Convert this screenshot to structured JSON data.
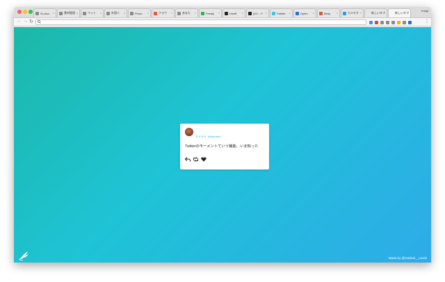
{
  "browser": {
    "tabs": [
      {
        "label": "Si-choc",
        "favicon": "folder-icon",
        "color": "#8a8a8a",
        "active": false
      },
      {
        "label": "素材管理",
        "favicon": "folder-icon",
        "color": "#8a8a8a",
        "active": false
      },
      {
        "label": "ペット",
        "favicon": "folder-icon",
        "color": "#8a8a8a",
        "active": false
      },
      {
        "label": "外国人",
        "favicon": "folder-icon",
        "color": "#8a8a8a",
        "active": false
      },
      {
        "label": "Photo",
        "favicon": "folder-icon",
        "color": "#8a8a8a",
        "active": false
      },
      {
        "label": "クラウ",
        "favicon": "cloud-app-icon",
        "color": "#e9553b",
        "active": false
      },
      {
        "label": "あなた",
        "favicon": "folder-icon",
        "color": "#8a8a8a",
        "active": false
      },
      {
        "label": "Feedly",
        "favicon": "feedly-icon",
        "color": "#2bb24c",
        "active": false
      },
      {
        "label": "Unoffi",
        "favicon": "github-icon",
        "color": "#222222",
        "active": false
      },
      {
        "label": "(I/O -- F",
        "favicon": "io-icon",
        "color": "#222222",
        "active": false
      },
      {
        "label": "Palette",
        "favicon": "palette-icon",
        "color": "#3fc3e8",
        "active": false
      },
      {
        "label": "Optim",
        "favicon": "optimize-icon",
        "color": "#2a6fd6",
        "active": false
      },
      {
        "label": "Birdy",
        "favicon": "birdy-icon",
        "color": "#d9583a",
        "active": false
      },
      {
        "label": "カメキチ",
        "favicon": "twitter-icon",
        "color": "#1da1f2",
        "active": false
      },
      {
        "label": "新しいタブ",
        "favicon": "blank-tab-icon",
        "color": "#e6e6e6",
        "active": false
      },
      {
        "label": "新しいタブ",
        "favicon": "blank-tab-icon",
        "color": "#f6f6f6",
        "active": true
      }
    ],
    "profile_name": "Imagi",
    "address": {
      "value": "",
      "icon": "search-icon"
    },
    "extensions": [
      {
        "name": "translate-icon",
        "color": "#4a8af4"
      },
      {
        "name": "gmail-icon",
        "color": "#d44638"
      },
      {
        "name": "camera-icon",
        "color": "#8a8a8a"
      },
      {
        "name": "bookmark-icon",
        "color": "#8a8a8a"
      },
      {
        "name": "feather-icon",
        "color": "#8a8a8a"
      },
      {
        "name": "star-icon",
        "color": "#f5b400"
      },
      {
        "name": "screen-icon",
        "color": "#8a8a8a"
      },
      {
        "name": "sync-icon",
        "color": "#2a6fd6"
      }
    ]
  },
  "tweet": {
    "author_name": "カメキチ",
    "author_handle": "@kameklt",
    "text": "Twitterのモーメントていう機能、いま知った"
  },
  "footer": {
    "credit": "Made by @Gabriel__Lewis"
  },
  "colors": {
    "gradient_start": "#1cb8a8",
    "gradient_mid": "#1ec3d6",
    "gradient_end": "#2eabe8",
    "link": "#27b3e3"
  }
}
